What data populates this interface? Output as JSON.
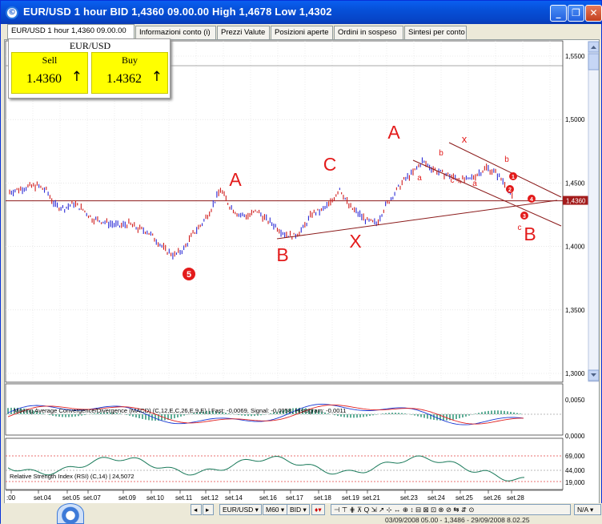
{
  "window": {
    "title": "EUR/USD 1 hour BID 1,4360 09.00.00 High 1,4678 Low 1,4302",
    "min_glyph": "_",
    "max_glyph": "❐",
    "close_glyph": "✕"
  },
  "tabs": [
    {
      "label": "EUR/USD 1 hour 1,4360 09.00.00",
      "active": true
    },
    {
      "label": "Informazioni conto (i)"
    },
    {
      "label": "Prezzi Valute"
    },
    {
      "label": "Posizioni aperte"
    },
    {
      "label": "Ordini in sospeso"
    },
    {
      "label": "Sintesi per conto"
    }
  ],
  "quote": {
    "symbol": "EUR/USD",
    "sell_label": "Sell",
    "sell_value": "1.4360",
    "buy_label": "Buy",
    "buy_value": "1.4362",
    "arrow": "↑"
  },
  "chart_data": {
    "type": "line",
    "title": "",
    "xlabel": "",
    "ylabel": "",
    "y_ticks": [
      "1,5500",
      "1,5000",
      "1,4500",
      "1,4000",
      "1,3500",
      "1,3000"
    ],
    "ylim": [
      1.3,
      1.55
    ],
    "current_price_label": "1,4360",
    "current_price": 1.436,
    "x_tick_labels": [
      ":00",
      "set.04",
      "set.05",
      "set.07",
      "set.09",
      "set.10",
      "set.11",
      "set.12",
      "set.14",
      "set.16",
      "set.17",
      "set.18",
      "set.19",
      "set.21",
      "set.23",
      "set.24",
      "set.25",
      "set.26",
      "set.28"
    ],
    "series": [
      {
        "x": [
          0,
          4,
          8,
          12,
          16,
          20,
          24,
          28,
          32,
          36,
          40,
          44,
          48,
          52,
          56,
          60,
          64,
          68,
          72,
          76,
          80,
          84,
          88,
          92,
          96,
          100,
          104,
          108,
          112,
          116,
          120,
          124,
          128,
          132,
          136,
          140,
          144,
          148,
          152,
          156,
          160,
          164,
          168,
          172,
          176,
          180,
          184,
          188,
          192,
          196,
          200,
          204,
          208,
          212,
          216,
          220
        ],
        "y": [
          1.443,
          1.445,
          1.447,
          1.448,
          1.444,
          1.432,
          1.43,
          1.434,
          1.429,
          1.422,
          1.42,
          1.418,
          1.416,
          1.418,
          1.414,
          1.412,
          1.405,
          1.397,
          1.393,
          1.398,
          1.41,
          1.418,
          1.43,
          1.445,
          1.432,
          1.425,
          1.424,
          1.428,
          1.421,
          1.416,
          1.41,
          1.408,
          1.414,
          1.426,
          1.428,
          1.434,
          1.446,
          1.432,
          1.426,
          1.42,
          1.418,
          1.432,
          1.442,
          1.452,
          1.458,
          1.467,
          1.462,
          1.458,
          1.456,
          1.453,
          1.452,
          1.457,
          1.462,
          1.458,
          1.45,
          1.436
        ]
      }
    ],
    "wave_labels": [
      "A",
      "B",
      "C",
      "X",
      "A",
      "x",
      "b",
      "a",
      "c",
      "a",
      "b",
      "B",
      "c",
      "5"
    ],
    "wave_circles": [
      "1",
      "2",
      "3",
      "4"
    ]
  },
  "macd": {
    "label": "Moving Average Convergence/Divergence (MACD) (C,12,E,C,26,E,9,E) | Fast: -0,0069, Signal: -0,0058, Histogram: -0,0011",
    "ticks": [
      "0,0050",
      "0,0000"
    ]
  },
  "rsi": {
    "label": "Relative Strength Index (RSI) (C,14) | 24,5072",
    "ticks": [
      "69,000",
      "44,000",
      "19,000"
    ]
  },
  "toolbar": {
    "symbol": "EUR/USD ▾",
    "period": "M60 ▾",
    "side": "BID ▾",
    "nav": "N/A ▾",
    "icons": "⊣ ⊤ ⋕ ⊼ Q ⇲ ↗ ⊹ ↔ ⊕ ↕ ⊟ ⊠ ⊡ ⊗ ⊘ ⇆ ⇵ ⊙"
  },
  "status": {
    "range": "03/09/2008 05.00 - 1,3486 - 29/09/2008 8.02.25"
  },
  "colors": {
    "price_up": "#2b2bd6",
    "price_down": "#d01c1c",
    "wave_label": "#e31b1b",
    "trendline": "#8b1a1a",
    "macd_fast": "#1a3ad4",
    "macd_signal": "#e02020",
    "histogram": "#1a8a6a",
    "rsi": "#1a7a5a"
  }
}
